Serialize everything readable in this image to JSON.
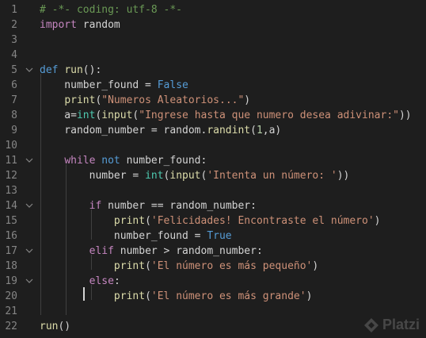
{
  "watermark": {
    "text": "Platzi"
  },
  "lines": [
    {
      "n": "1",
      "fold": "",
      "tokens": [
        {
          "t": "# -*- coding: utf-8 -*-",
          "k": "comment"
        }
      ]
    },
    {
      "n": "2",
      "fold": "",
      "tokens": [
        {
          "t": "import",
          "k": "keyword"
        },
        {
          "t": " random",
          "k": "plain"
        }
      ]
    },
    {
      "n": "3",
      "fold": "",
      "tokens": []
    },
    {
      "n": "4",
      "fold": "",
      "tokens": []
    },
    {
      "n": "5",
      "fold": "v",
      "tokens": [
        {
          "t": "def",
          "k": "def"
        },
        {
          "t": " ",
          "k": "plain"
        },
        {
          "t": "run",
          "k": "func"
        },
        {
          "t": "():",
          "k": "plain"
        }
      ]
    },
    {
      "n": "6",
      "fold": "",
      "tokens": [
        {
          "t": "    number_found = ",
          "k": "plain"
        },
        {
          "t": "False",
          "k": "const"
        }
      ]
    },
    {
      "n": "7",
      "fold": "",
      "tokens": [
        {
          "t": "    ",
          "k": "plain"
        },
        {
          "t": "print",
          "k": "func"
        },
        {
          "t": "(",
          "k": "plain"
        },
        {
          "t": "\"Numeros Aleatorios...\"",
          "k": "string"
        },
        {
          "t": ")",
          "k": "plain"
        }
      ]
    },
    {
      "n": "8",
      "fold": "",
      "tokens": [
        {
          "t": "    a=",
          "k": "plain"
        },
        {
          "t": "int",
          "k": "builtin"
        },
        {
          "t": "(",
          "k": "plain"
        },
        {
          "t": "input",
          "k": "func"
        },
        {
          "t": "(",
          "k": "plain"
        },
        {
          "t": "\"Ingrese hasta que numero desea adivinar:\"",
          "k": "string"
        },
        {
          "t": "))",
          "k": "plain"
        }
      ]
    },
    {
      "n": "9",
      "fold": "",
      "tokens": [
        {
          "t": "    random_number = random.",
          "k": "plain"
        },
        {
          "t": "randint",
          "k": "func"
        },
        {
          "t": "(",
          "k": "plain"
        },
        {
          "t": "1",
          "k": "number"
        },
        {
          "t": ",a)",
          "k": "plain"
        }
      ]
    },
    {
      "n": "10",
      "fold": "",
      "tokens": []
    },
    {
      "n": "11",
      "fold": "v",
      "tokens": [
        {
          "t": "    ",
          "k": "plain"
        },
        {
          "t": "while",
          "k": "keyword"
        },
        {
          "t": " ",
          "k": "plain"
        },
        {
          "t": "not",
          "k": "def"
        },
        {
          "t": " number_found:",
          "k": "plain"
        }
      ]
    },
    {
      "n": "12",
      "fold": "",
      "tokens": [
        {
          "t": "        number = ",
          "k": "plain"
        },
        {
          "t": "int",
          "k": "builtin"
        },
        {
          "t": "(",
          "k": "plain"
        },
        {
          "t": "input",
          "k": "func"
        },
        {
          "t": "(",
          "k": "plain"
        },
        {
          "t": "'Intenta un número: '",
          "k": "string"
        },
        {
          "t": "))",
          "k": "plain"
        }
      ]
    },
    {
      "n": "13",
      "fold": "",
      "tokens": []
    },
    {
      "n": "14",
      "fold": "v",
      "tokens": [
        {
          "t": "        ",
          "k": "plain"
        },
        {
          "t": "if",
          "k": "keyword"
        },
        {
          "t": " number == random_number:",
          "k": "plain"
        }
      ]
    },
    {
      "n": "15",
      "fold": "",
      "tokens": [
        {
          "t": "            ",
          "k": "plain"
        },
        {
          "t": "print",
          "k": "func"
        },
        {
          "t": "(",
          "k": "plain"
        },
        {
          "t": "'Felicidades! Encontraste el número'",
          "k": "string"
        },
        {
          "t": ")",
          "k": "plain"
        }
      ]
    },
    {
      "n": "16",
      "fold": "",
      "tokens": [
        {
          "t": "            number_found = ",
          "k": "plain"
        },
        {
          "t": "True",
          "k": "const"
        }
      ]
    },
    {
      "n": "17",
      "fold": "v",
      "tokens": [
        {
          "t": "        ",
          "k": "plain"
        },
        {
          "t": "elif",
          "k": "keyword"
        },
        {
          "t": " number > random_number:",
          "k": "plain"
        }
      ]
    },
    {
      "n": "18",
      "fold": "",
      "tokens": [
        {
          "t": "            ",
          "k": "plain"
        },
        {
          "t": "print",
          "k": "func"
        },
        {
          "t": "(",
          "k": "plain"
        },
        {
          "t": "'El número es más pequeño'",
          "k": "string"
        },
        {
          "t": ")",
          "k": "plain"
        }
      ]
    },
    {
      "n": "19",
      "fold": "v",
      "tokens": [
        {
          "t": "        ",
          "k": "plain"
        },
        {
          "t": "else",
          "k": "keyword"
        },
        {
          "t": ":",
          "k": "plain"
        }
      ]
    },
    {
      "n": "20",
      "fold": "",
      "tokens": [
        {
          "t": "            ",
          "k": "plain"
        },
        {
          "t": "print",
          "k": "func"
        },
        {
          "t": "(",
          "k": "plain"
        },
        {
          "t": "'El número es más grande'",
          "k": "string"
        },
        {
          "t": ")",
          "k": "plain"
        }
      ]
    },
    {
      "n": "21",
      "fold": "",
      "tokens": []
    },
    {
      "n": "22",
      "fold": "",
      "tokens": [
        {
          "t": "run",
          "k": "func"
        },
        {
          "t": "()",
          "k": "plain"
        }
      ]
    }
  ]
}
